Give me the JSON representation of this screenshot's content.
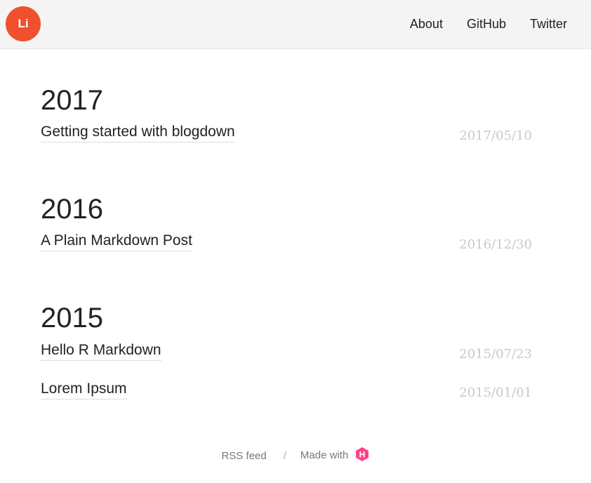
{
  "header": {
    "logo_text": "Li",
    "nav": [
      {
        "label": "About"
      },
      {
        "label": "GitHub"
      },
      {
        "label": "Twitter"
      }
    ]
  },
  "archive": [
    {
      "year": "2017",
      "posts": [
        {
          "title": "Getting started with blogdown",
          "date": "2017/05/10"
        }
      ]
    },
    {
      "year": "2016",
      "posts": [
        {
          "title": "A Plain Markdown Post",
          "date": "2016/12/30"
        }
      ]
    },
    {
      "year": "2015",
      "posts": [
        {
          "title": "Hello R Markdown",
          "date": "2015/07/23"
        },
        {
          "title": "Lorem Ipsum",
          "date": "2015/01/01"
        }
      ]
    }
  ],
  "footer": {
    "rss_label": "RSS feed",
    "separator": "/",
    "made_with_label": "Made with",
    "icon": "hugo-icon"
  },
  "colors": {
    "accent": "#f0502d",
    "header_bg": "#f4f4f4",
    "date_text": "#c8c8c8",
    "hugo_pink": "#ff4088"
  }
}
